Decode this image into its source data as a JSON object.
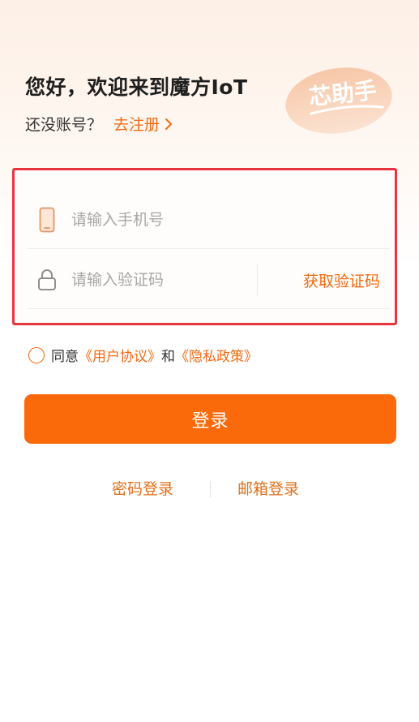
{
  "header": {
    "greeting": "您好，欢迎来到魔方IoT",
    "no_account_text": "还没账号？",
    "register_link": "去注册"
  },
  "badge": {
    "text": "芯助手"
  },
  "form": {
    "phone_placeholder": "请输入手机号",
    "code_placeholder": "请输入验证码",
    "get_code_label": "获取验证码"
  },
  "agreement": {
    "prefix": "同意",
    "user_agreement": "《用户协议》",
    "and": "和",
    "privacy_policy": "《隐私政策》",
    "checked": false
  },
  "login": {
    "button_label": "登录"
  },
  "alt_login": {
    "password_login": "密码登录",
    "email_login": "邮箱登录"
  },
  "colors": {
    "accent": "#fb6a0a",
    "link": "#f26a12",
    "highlight_border": "#e8343c"
  }
}
